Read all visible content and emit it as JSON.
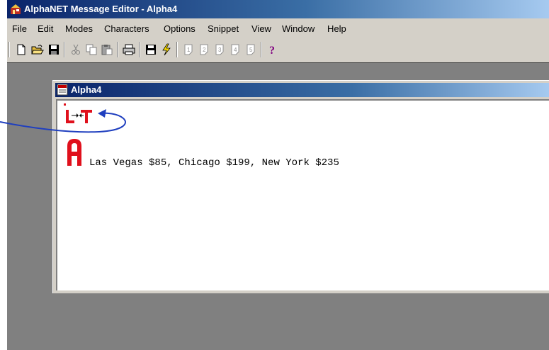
{
  "window": {
    "title": "AlphaNET Message Editor - Alpha4"
  },
  "menubar": {
    "items": [
      "File",
      "Edit",
      "Modes",
      "Characters",
      "Options",
      "Snippet",
      "View",
      "Window",
      "Help"
    ]
  },
  "toolbar": {
    "icons": [
      "new-icon",
      "open-icon",
      "save-icon",
      "cut-icon",
      "copy-icon",
      "paste-icon",
      "print-icon",
      "save-to-sign-icon",
      "send-icon",
      "snippet-1-icon",
      "snippet-2-icon",
      "snippet-3-icon",
      "snippet-4-icon",
      "snippet-5-icon",
      "help-icon"
    ]
  },
  "child_window": {
    "title": "Alpha4",
    "message": "Las Vegas $85, Chicago $199, New York $235"
  },
  "colors": {
    "titlebar_start": "#0a246a",
    "titlebar_end": "#a6caf0",
    "mdi_background": "#808080",
    "code_red": "#e0101c",
    "annotation_arrow": "#1f3fbf"
  }
}
